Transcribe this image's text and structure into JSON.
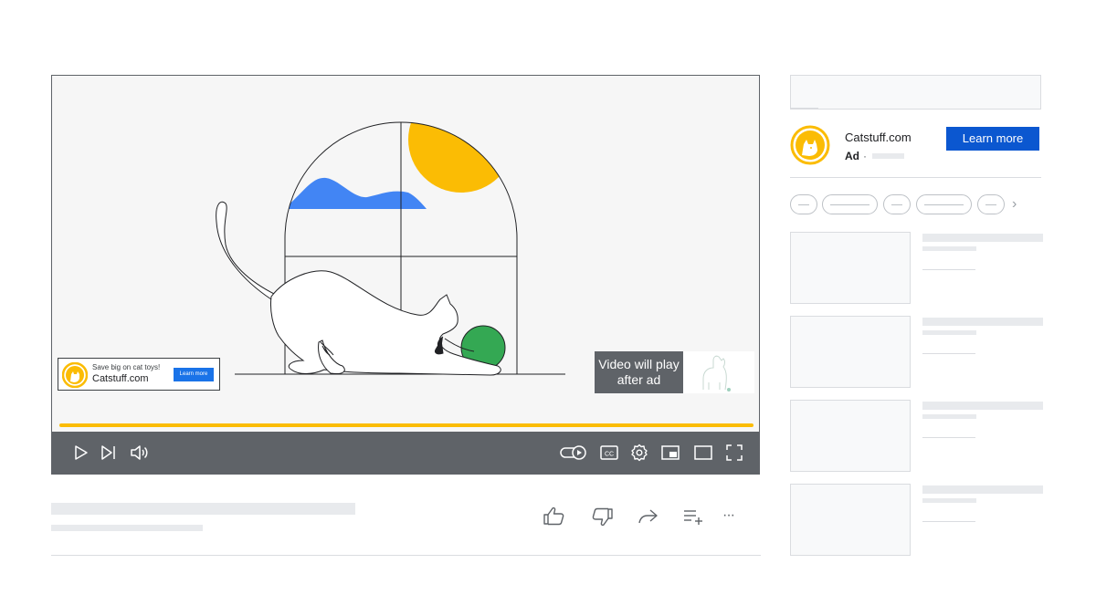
{
  "player": {
    "overlay_ad": {
      "tagline": "Save big on cat toys!",
      "site": "Catstuff.com",
      "cta": "Learn more"
    },
    "after_ad_text": "Video will play after ad",
    "icons": [
      "play-icon",
      "skip-next-icon",
      "volume-icon",
      "autoplay-toggle-icon",
      "captions-icon",
      "settings-icon",
      "miniplayer-icon",
      "theater-mode-icon",
      "fullscreen-icon"
    ],
    "captions_label": "CC",
    "progress_color": "#fbbc04"
  },
  "actions": {
    "icons": [
      "like-icon",
      "dislike-icon",
      "share-icon",
      "save-to-playlist-icon",
      "more-icon"
    ],
    "more_label": "···"
  },
  "sidebar": {
    "ad": {
      "site": "Catstuff.com",
      "label": "Ad",
      "separator": "·",
      "cta": "Learn more",
      "cta_color": "#0b57d0"
    },
    "chips_next_icon": "chevron-right-icon",
    "chips_next_glyph": "›"
  },
  "colors": {
    "sun": "#fbbc04",
    "cloud": "#4285f4",
    "ball": "#34a853",
    "controls": "#5f6368"
  }
}
